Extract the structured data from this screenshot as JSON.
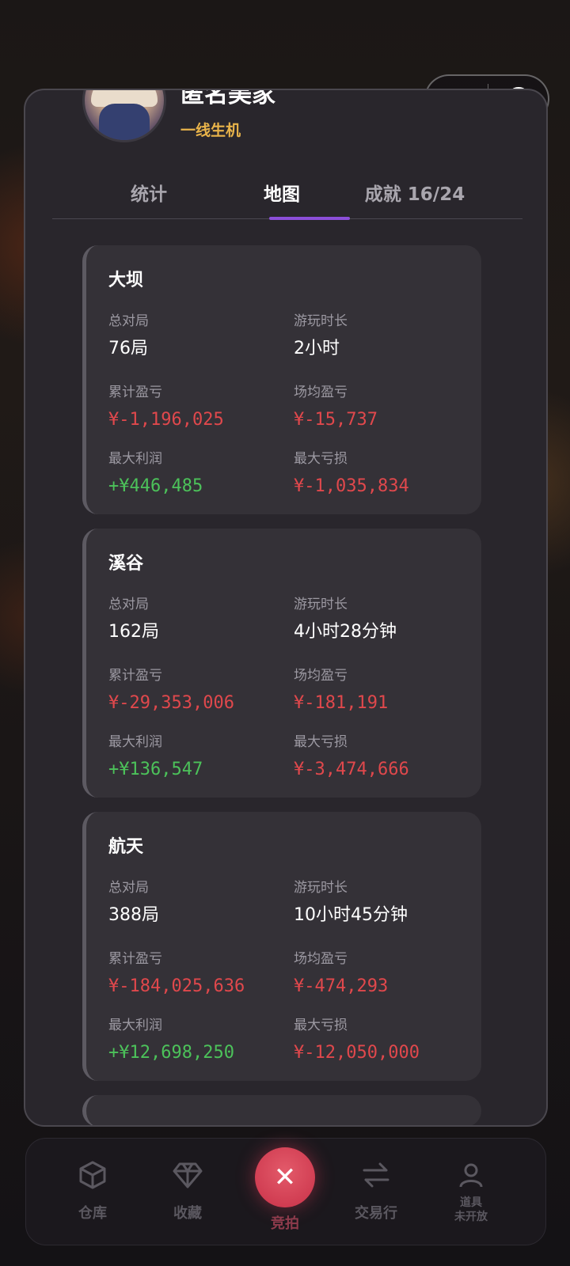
{
  "user": {
    "name": "匿名美家",
    "tag": "一线生机"
  },
  "tabs": [
    {
      "label": "统计",
      "active": false
    },
    {
      "label": "地图",
      "active": true
    },
    {
      "label": "成就 16/24",
      "active": false
    }
  ],
  "labels": {
    "total_games": "总对局",
    "play_time": "游玩时长",
    "cumulative_pl": "累计盈亏",
    "avg_pl": "场均盈亏",
    "max_profit": "最大利润",
    "max_loss": "最大亏损"
  },
  "maps": [
    {
      "name": "大坝",
      "total_games": "76局",
      "play_time": "2小时",
      "cumulative_pl": "¥-1,196,025",
      "avg_pl": "¥-15,737",
      "max_profit": "+¥446,485",
      "max_loss": "¥-1,035,834"
    },
    {
      "name": "溪谷",
      "total_games": "162局",
      "play_time": "4小时28分钟",
      "cumulative_pl": "¥-29,353,006",
      "avg_pl": "¥-181,191",
      "max_profit": "+¥136,547",
      "max_loss": "¥-3,474,666"
    },
    {
      "name": "航天",
      "total_games": "388局",
      "play_time": "10小时45分钟",
      "cumulative_pl": "¥-184,025,636",
      "avg_pl": "¥-474,293",
      "max_profit": "+¥12,698,250",
      "max_loss": "¥-12,050,000"
    }
  ],
  "nav": {
    "warehouse": "仓库",
    "favorites": "收藏",
    "auction": "竞拍",
    "trade": "交易行",
    "props": "道具",
    "props_status": "未开放"
  },
  "colors": {
    "negative": "#e0484c",
    "positive": "#4cc25a",
    "accent": "#8c4fd9",
    "tag": "#e8b34a"
  }
}
